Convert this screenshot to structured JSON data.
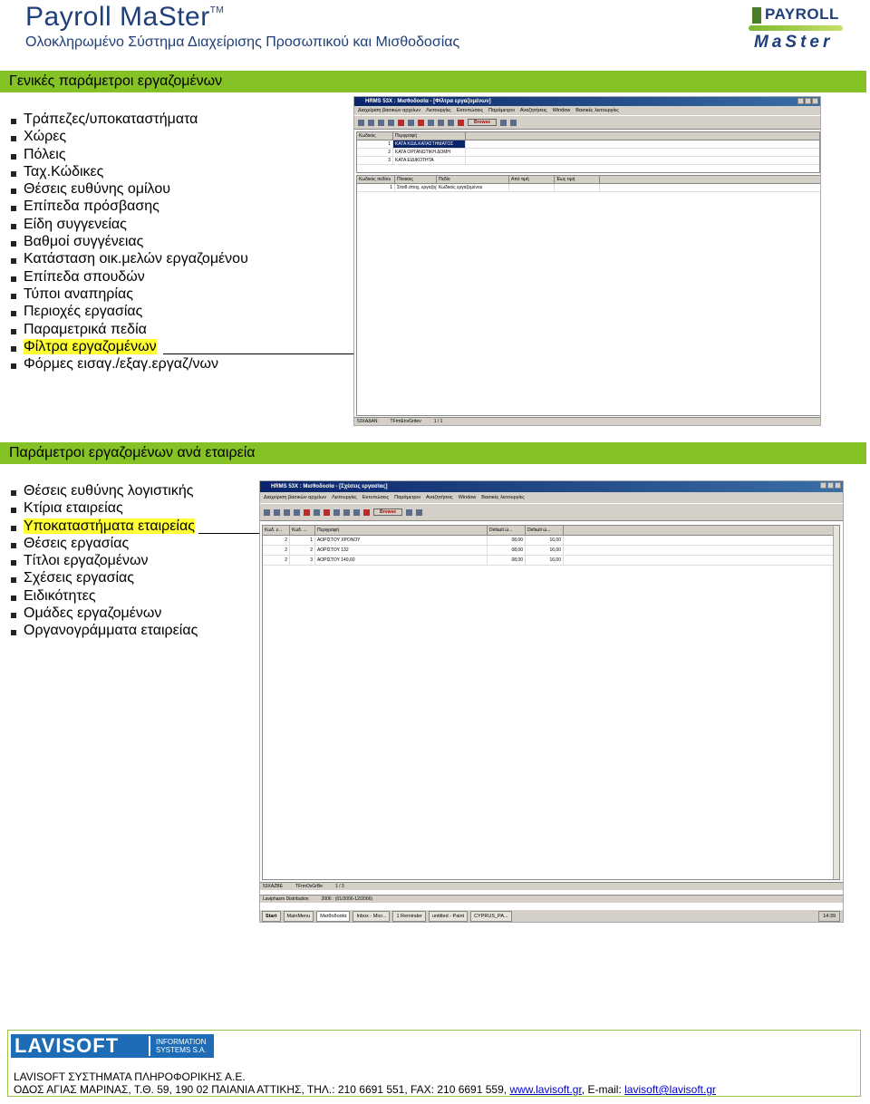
{
  "header": {
    "title": "Payroll MaSter",
    "tm": "TM",
    "subtitle": "Ολοκληρωμένο Σύστημα Διαχείρισης Προσωπικού και Μισθοδοσίας",
    "logo_top": "PAYROLL",
    "logo_bottom": "MaSter"
  },
  "section1": {
    "heading": "Γενικές παράμετροι εργαζομένων",
    "items": [
      "Τράπεζες/υποκαταστήματα",
      "Χώρες",
      "Πόλεις",
      "Ταχ.Κώδικες",
      "Θέσεις ευθύνης ομίλου",
      "Επίπεδα πρόσβασης",
      "Είδη συγγενείας",
      "Βαθμοί συγγένειας",
      "Κατάσταση οικ.μελών εργαζομένου",
      "Επίπεδα σπουδών",
      "Τύποι αναπηρίας",
      "Περιοχές εργασίας",
      "Παραμετρικά πεδία",
      "Φίλτρα εργαζομένων",
      "Φόρμες εισαγ./εξαγ.εργαζ/νων"
    ],
    "highlighted_index": 13,
    "screenshot": {
      "window_title": "HRMS 53X : Μισθοδοσία - [Φίλτρα εργαζομένων]",
      "menu": [
        "Διαχείριση βασικών αρχείων",
        "Λειτουργίες",
        "Εκτυπώσεις",
        "Παράμετροι",
        "Αναζητήσεις",
        "Window",
        "Βασικές λειτουργίες"
      ],
      "lang": "Greek",
      "browse": "Browse",
      "grid1_headers": [
        "Κωδικός",
        "Περιγραφή"
      ],
      "grid1_rows": [
        [
          "1",
          "ΚΑΤΑ ΚΩΔ.ΚΑΤΑΣΤΗΜΑΤΟΣ"
        ],
        [
          "2",
          "ΚΑΤΑ ΟΡΓΑΝΩΤΙΚΗ ΔΟΜΗ"
        ],
        [
          "3",
          "ΚΑΤΑ ΕΙΔΙΚΟΤΗΤΑ"
        ]
      ],
      "grid2_headers": [
        "Κωδικός πεδίου",
        "Πίνακας",
        "Πεδίο",
        "Από τιμή",
        "Έως τιμή"
      ],
      "grid2_rows": [
        [
          "1",
          "Στοιθ.στοιχ. εργαζομέ",
          "Κωδικός εργαζομένου",
          "",
          ""
        ]
      ],
      "status": [
        "53ΧΑΔΑΝ",
        "TFrmEnvGrdev",
        "1 / 1"
      ]
    }
  },
  "section2": {
    "heading": "Παράμετροι εργαζομένων ανά εταιρεία",
    "items": [
      "Θέσεις ευθύνης λογιστικής",
      "Κτίρια εταιρείας",
      "Υποκαταστήματα εταιρείας",
      "Θέσεις εργασίας",
      "Τίτλοι εργαζομένων",
      "Σχέσεις εργασίας",
      "Ειδικότητες",
      "Ομάδες εργαζομένων",
      "Οργανογράμματα εταιρείας"
    ],
    "highlighted_index": 2,
    "screenshot": {
      "window_title": "HRMS 53X : Μισθοδοσία - [Σχέσεις εργασίας]",
      "menu": [
        "Διαχείριση βασικών αρχείων",
        "Λειτουργίες",
        "Εκτυπώσεις",
        "Παράμετροι",
        "Αναζητήσεις",
        "Window",
        "Βασικές λειτουργίες"
      ],
      "lang": "Greek",
      "browse": "Browse",
      "grid_headers": [
        "Κωδ. ε...",
        "Κωδ. ...",
        "Περιγραφή",
        "Default ώ...",
        "Default ώ..."
      ],
      "grid_rows": [
        [
          "2",
          "1",
          "ΑΟΡΙΣΤΟΥ ΧΡΟΝΟΥ",
          "08,00",
          "16,00"
        ],
        [
          "2",
          "2",
          "ΑΟΡΙΣΤΟΥ 132",
          "08,00",
          "16,00"
        ],
        [
          "2",
          "3",
          "ΑΟΡΙΣΤΟΥ 149,60",
          "08,00",
          "16,00"
        ]
      ],
      "status": [
        "53ΧΑΖΒΕ",
        "TFrmOvGrBe",
        "1 / 3"
      ],
      "status2": [
        "Laviphasm Distribution",
        "2006 : (01/2006-12/2006)"
      ],
      "taskbar": [
        "Start",
        "MainMenu",
        "Μισθοδοσία",
        "Inbox - Micr...",
        "1 Reminder",
        "untitled - Paint",
        "CYPRUS_PA..."
      ],
      "clock": "14:39"
    }
  },
  "footer": {
    "brand": "LAVISOFT",
    "brand_sub1": "INFORMATION",
    "brand_sub2": "SYSTEMS S.A.",
    "company": "LAVISOFT ΣΥΣΤΗΜΑΤΑ ΠΛΗΡΟΦΟΡΙΚΗΣ Α.Ε.",
    "address": "ΟΔΟΣ ΑΓΙΑΣ ΜΑΡΙΝΑΣ, Τ.Θ. 59, 190 02 ΠΑΙΑΝΙΑ ΑΤΤΙΚΗΣ, ΤΗΛ.:  210 6691 551, FAX: 210 6691 559, ",
    "website": "www.lavisoft.gr",
    "email_label": ", E-mail: ",
    "email": "lavisoft@lavisoft.gr"
  }
}
